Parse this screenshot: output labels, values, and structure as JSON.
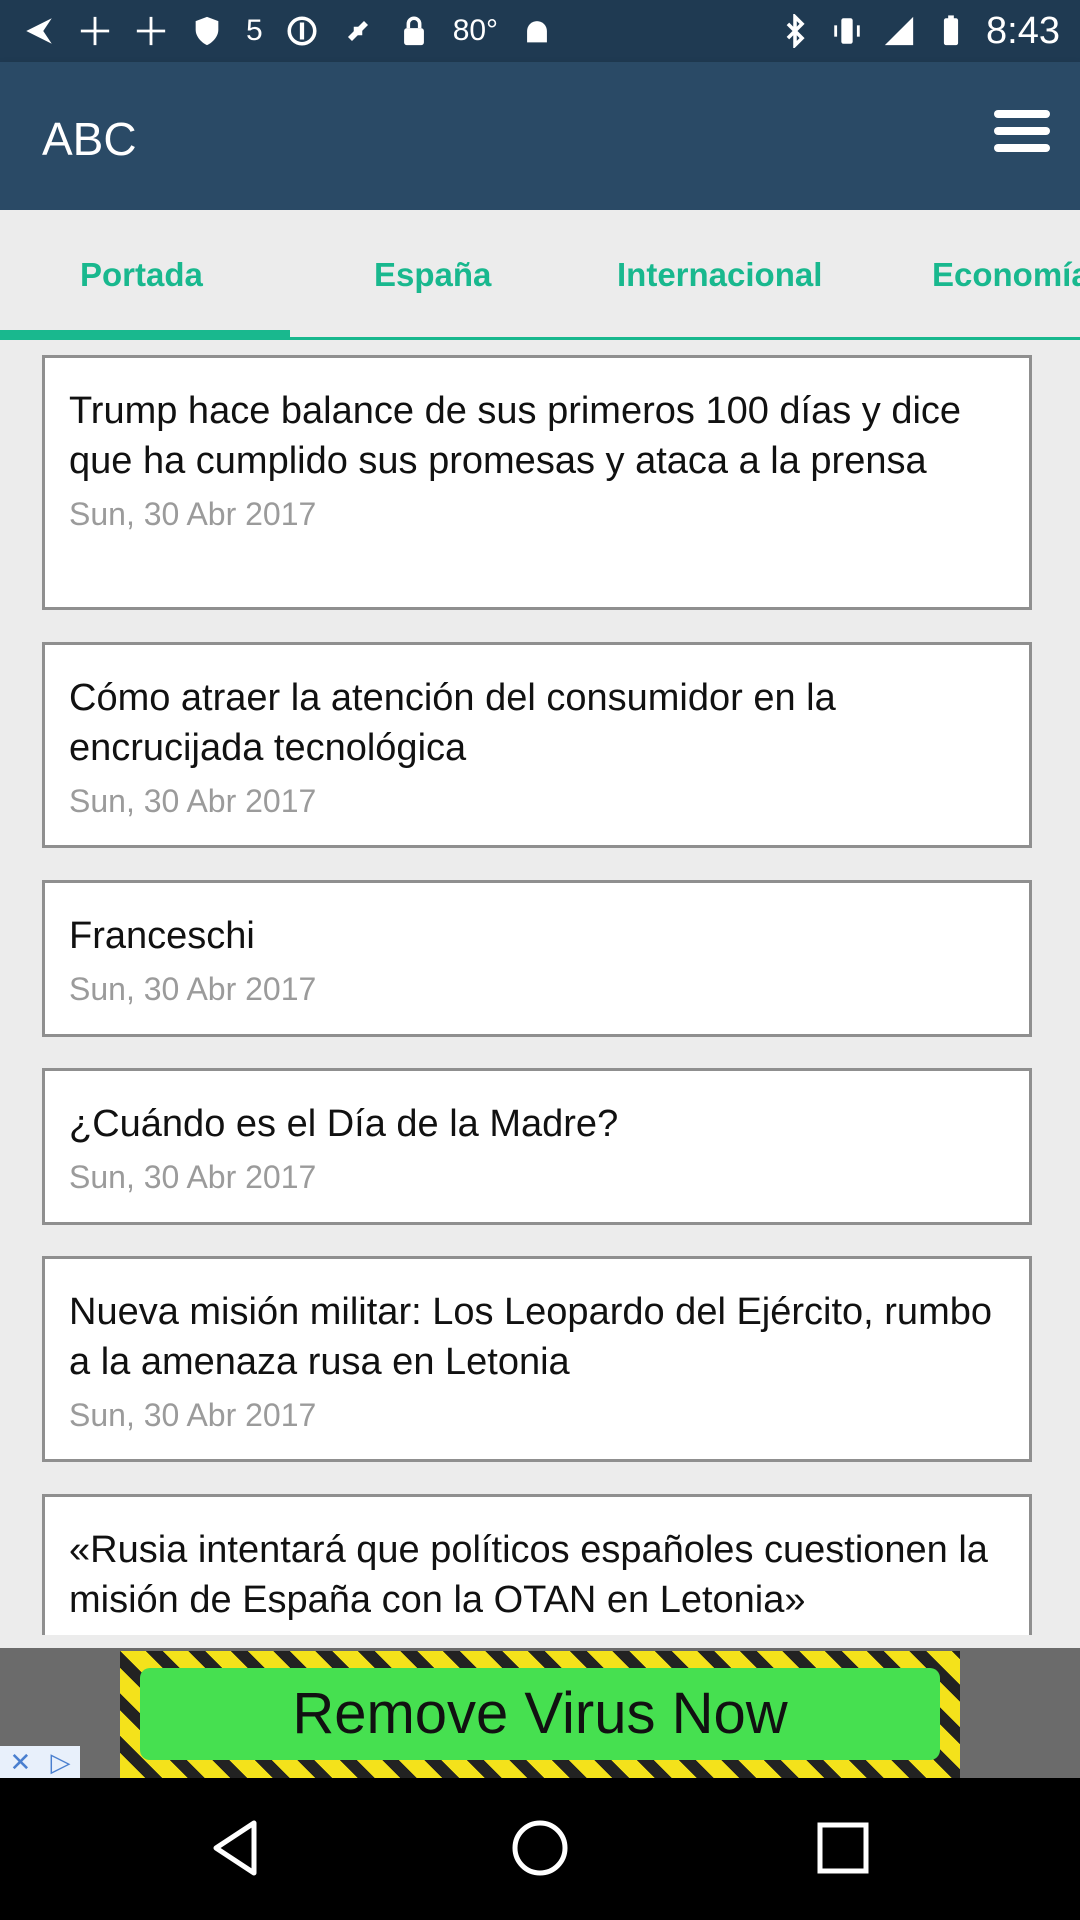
{
  "status_bar": {
    "time": "8:43",
    "temperature": "80°",
    "number": "5",
    "left_icons": [
      "back-arrow-icon",
      "fan-icon",
      "fan-icon",
      "shield-icon",
      "number-icon",
      "circle-icon",
      "satellite-icon",
      "lock-icon",
      "temperature-text",
      "android-icon"
    ],
    "right_icons": [
      "bluetooth-icon",
      "vibrate-icon",
      "signal-icon",
      "battery-icon"
    ]
  },
  "app_bar": {
    "title": "ABC",
    "menu_icon": "menu-icon"
  },
  "tabs": [
    {
      "label": "Portada",
      "selected": true
    },
    {
      "label": "España",
      "selected": false
    },
    {
      "label": "Internacional",
      "selected": false
    },
    {
      "label": "Economía",
      "selected": false
    }
  ],
  "accent_color": "#19b88e",
  "articles": [
    {
      "title": "Trump hace balance de sus primeros 100 días y dice que ha cumplido sus promesas y ataca a la prensa",
      "date": "Sun, 30 Abr 2017"
    },
    {
      "title": "Cómo atraer la atención del consumidor en la encrucijada tecnológica",
      "date": "Sun, 30 Abr 2017"
    },
    {
      "title": "Franceschi",
      "date": "Sun, 30 Abr 2017"
    },
    {
      "title": "¿Cuándo es el Día de la Madre?",
      "date": "Sun, 30 Abr 2017"
    },
    {
      "title": "Nueva misión militar: Los Leopardo del Ejército, rumbo a la amenaza rusa en Letonia",
      "date": "Sun, 30 Abr 2017"
    },
    {
      "title": "«Rusia intentará que políticos españoles cuestionen la misión de España con la OTAN en Letonia»",
      "date": ""
    }
  ],
  "ad": {
    "text": "Remove Virus Now"
  },
  "nav_bar": [
    "back-icon",
    "home-icon",
    "recents-icon"
  ]
}
